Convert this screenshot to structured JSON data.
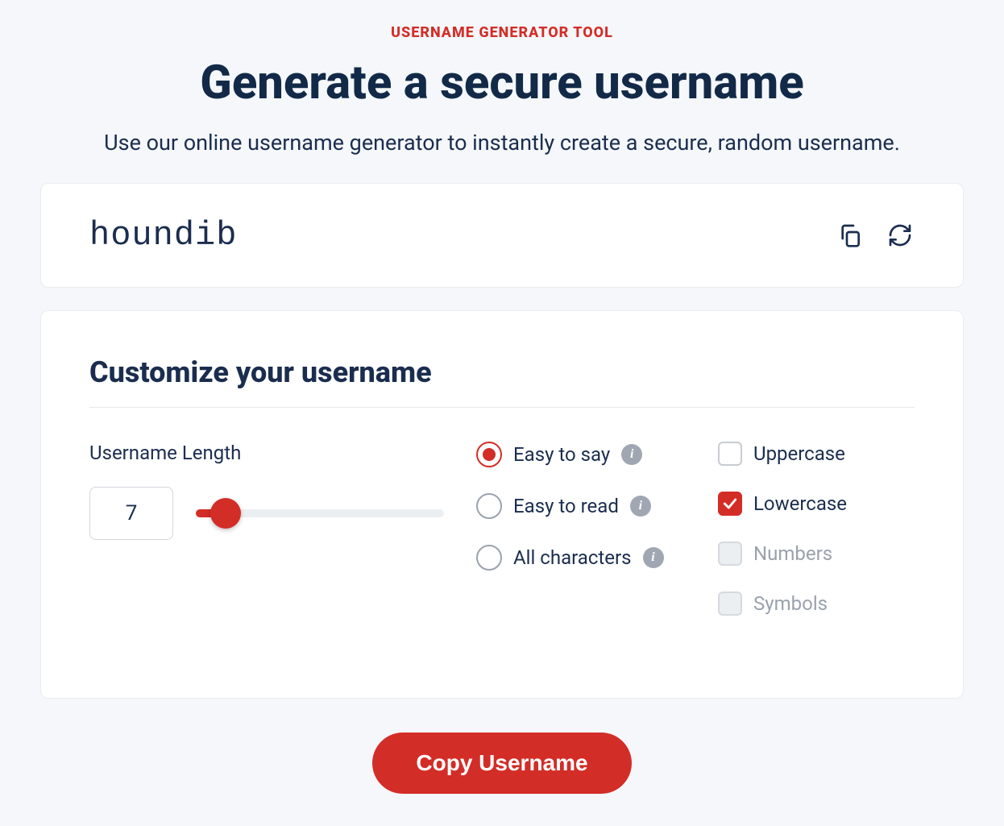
{
  "header": {
    "eyebrow": "USERNAME GENERATOR TOOL",
    "headline": "Generate a secure username",
    "subhead": "Use our online username generator to instantly create a secure, random username."
  },
  "output": {
    "username": "houndib"
  },
  "customize": {
    "title": "Customize your username",
    "length": {
      "label": "Username Length",
      "value": "7"
    },
    "modes": {
      "easy_say": {
        "label": "Easy to say",
        "selected": true
      },
      "easy_read": {
        "label": "Easy to read",
        "selected": false
      },
      "all_chars": {
        "label": "All characters",
        "selected": false
      }
    },
    "charsets": {
      "uppercase": {
        "label": "Uppercase",
        "checked": false,
        "disabled": false
      },
      "lowercase": {
        "label": "Lowercase",
        "checked": true,
        "disabled": false
      },
      "numbers": {
        "label": "Numbers",
        "checked": false,
        "disabled": true
      },
      "symbols": {
        "label": "Symbols",
        "checked": false,
        "disabled": true
      }
    }
  },
  "cta": {
    "copy_label": "Copy Username"
  },
  "colors": {
    "accent": "#d32d27",
    "ink": "#1b2d4f"
  }
}
